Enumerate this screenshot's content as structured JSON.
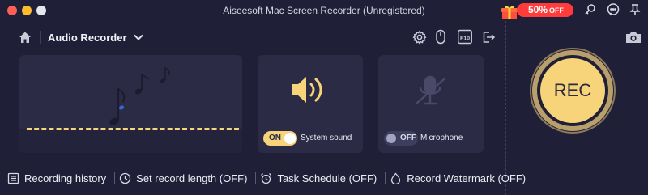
{
  "window": {
    "title": "Aiseesoft Mac Screen Recorder (Unregistered)",
    "promo_percent": "50%",
    "promo_suffix": "OFF"
  },
  "header": {
    "mode_title": "Audio Recorder"
  },
  "system_sound": {
    "toggle_state": "ON",
    "label": "System sound"
  },
  "microphone": {
    "toggle_state": "OFF",
    "label": "Microphone"
  },
  "record": {
    "label": "REC"
  },
  "toolbar": {
    "f10_label": "F10"
  },
  "bottom_bar": {
    "recording_history": "Recording history",
    "set_record_length": "Set record length (OFF)",
    "task_schedule": "Task Schedule (OFF)",
    "record_watermark": "Record Watermark (OFF)"
  },
  "colors": {
    "background": "#1f1f37",
    "card": "#2b2b45",
    "accent": "#f7d37a",
    "promo": "#ff3b3b"
  }
}
